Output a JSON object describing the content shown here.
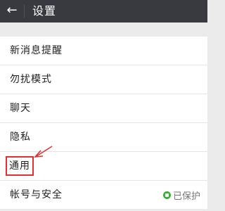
{
  "header": {
    "back_icon": "arrow-left-icon",
    "title": "设置"
  },
  "settings": {
    "items": [
      {
        "label": "新消息提醒"
      },
      {
        "label": "勿扰模式"
      },
      {
        "label": "聊天"
      },
      {
        "label": "隐私"
      },
      {
        "label": "通用"
      },
      {
        "label": "帐号与安全",
        "status": "已保护",
        "status_icon": "shield-check-icon",
        "status_color": "#3cb035"
      }
    ]
  },
  "annotation": {
    "highlight_color": "#e23030",
    "pointer_icon": "red-arrow-icon"
  }
}
